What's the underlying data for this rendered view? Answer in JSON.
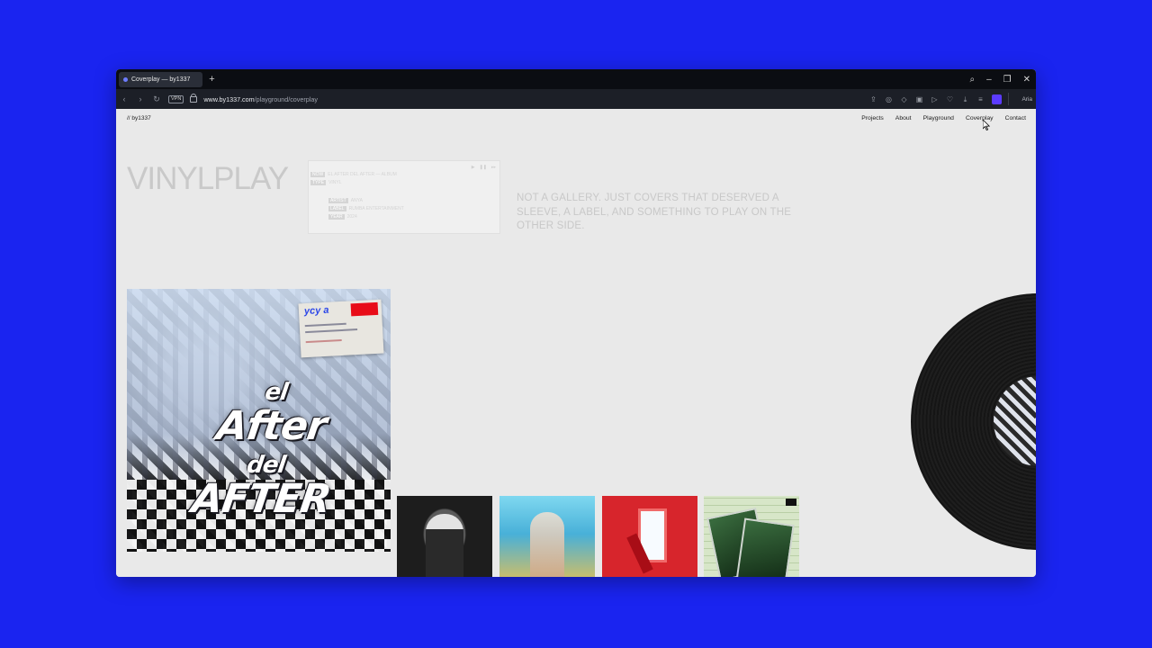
{
  "browser": {
    "tab_title": "Coverplay — by1337",
    "new_tab_symbol": "+",
    "vpn_label": "VPN",
    "url_host": "www.by1337.com",
    "url_path": "/playground/coverplay",
    "aria_label": "Aria"
  },
  "site": {
    "logo": "// by1337",
    "nav": [
      "Projects",
      "About",
      "Playground",
      "Coverplay",
      "Contact"
    ],
    "headline": "VINYLPLAY",
    "tagline": "NOT A GALLERY. JUST COVERS THAT DESERVED A SLEEVE, A LABEL, AND SOMETHING TO PLAY ON THE OTHER SIDE.",
    "info_card": {
      "rows": [
        {
          "tag": "NOW",
          "text": "EL AFTER DEL AFTER — ALBUM"
        },
        {
          "tag": "TYPE",
          "text": "VINYL"
        },
        {
          "tag": "ARTIST",
          "text": "ANYA"
        },
        {
          "tag": "LABEL",
          "text": "RUMBA ENTERTAINMENT"
        },
        {
          "tag": "YEAR",
          "text": "2024"
        }
      ]
    },
    "featured_cover": {
      "title_line1": "el",
      "title_line2": "After",
      "title_line3": "del",
      "title_line4": "AFTER",
      "sticker_logo": "ycy a"
    }
  },
  "colors": {
    "background": "#1a24f0",
    "page": "#e9e9e9",
    "accent": "#5b3bff"
  }
}
